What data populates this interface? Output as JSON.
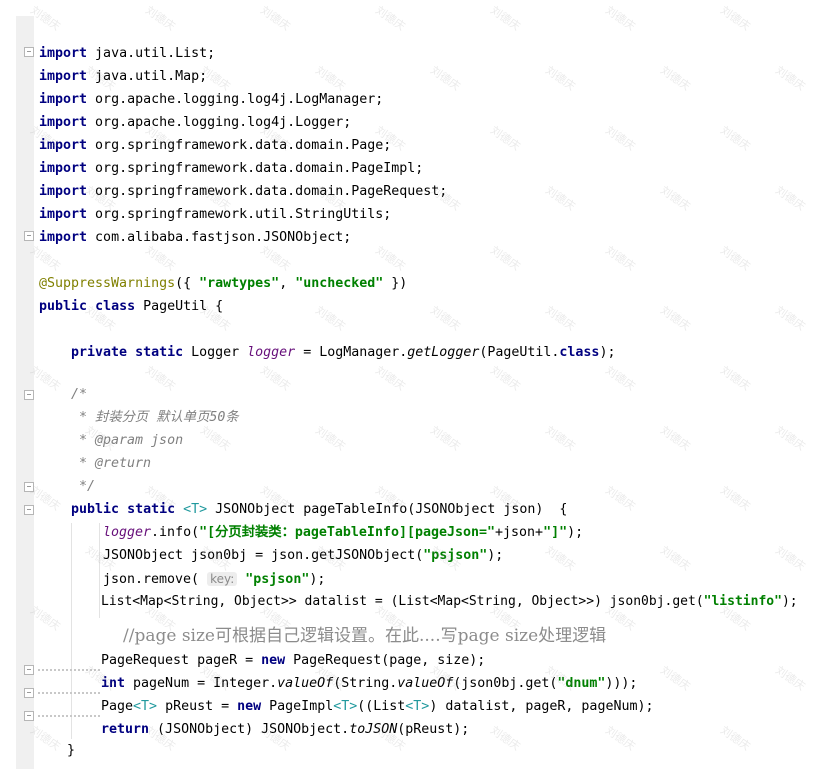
{
  "code": {
    "imports": [
      {
        "keyword": "import",
        "path": " java.util.List;"
      },
      {
        "keyword": "import",
        "path": " java.util.Map;"
      },
      {
        "keyword": "import",
        "path": " org.apache.logging.log4j.LogManager;"
      },
      {
        "keyword": "import",
        "path": " org.apache.logging.log4j.Logger;"
      },
      {
        "keyword": "import",
        "path": " org.springframework.data.domain.Page;"
      },
      {
        "keyword": "import",
        "path": " org.springframework.data.domain.PageImpl;"
      },
      {
        "keyword": "import",
        "path": " org.springframework.data.domain.PageRequest;"
      },
      {
        "keyword": "import",
        "path": " org.springframework.util.StringUtils;"
      },
      {
        "keyword": "import",
        "path": " com.alibaba.fastjson.JSONObject;"
      }
    ],
    "annotation": "@SuppressWarnings",
    "annotation_open": "({ ",
    "annotation_str1": "\"rawtypes\"",
    "annotation_sep": ", ",
    "annotation_str2": "\"unchecked\"",
    "annotation_close": " })",
    "kw_public": "public",
    "kw_class": "class",
    "class_rest": " PageUtil {",
    "kw_private": "private",
    "kw_static": "static",
    "logger_type": " Logger ",
    "logger_field": "logger",
    "logger_eq": " = LogManager.",
    "logger_method": "getLogger",
    "logger_arg": "(PageUtil.",
    "kw_class2": "class",
    "logger_end": ");",
    "doc_open": "/*",
    "doc_line1": " * 封装分页 默认单页50条",
    "doc_line2": " * @param json",
    "doc_line3": " * @return",
    "doc_close": " */",
    "m_public": "public",
    "m_static": "static",
    "m_generic": "<T>",
    "m_sig": " JSONObject pageTableInfo(JSONObject json)  {",
    "l1_field": "logger",
    "l1_mid": ".info(",
    "l1_str1": "\"[分页封装类：pageTableInfo][pageJson=\"",
    "l1_plus": "+json+",
    "l1_str2": "\"]\"",
    "l1_end": ");",
    "l2_pre": "JSONObject json0bj = json.getJSONObject(",
    "l2_str": "\"psjson\"",
    "l2_end": ");",
    "l3_pre": "json.remove( ",
    "l3_hint": "key:",
    "l3_str": "\"psjson\"",
    "l3_end": ");",
    "l4_pre": "List<Map<String, Object>> datalist = (List<Map<String, Object>>) json0bj.get(",
    "l4_str": "\"listinfo\"",
    "l4_end": ");",
    "l5_comment": "//page size可根据自己逻辑设置。在此....写page size处理逻辑",
    "l6_pre": "PageRequest pageR = ",
    "l6_kw": "new",
    "l6_end": " PageRequest(page, size);",
    "l7_kw": "int",
    "l7_pre": " pageNum = Integer.",
    "l7_m1": "valueOf",
    "l7_mid": "(String.",
    "l7_m2": "valueOf",
    "l7_mid2": "(json0bj.get(",
    "l7_str": "\"dnum\"",
    "l7_end": ")));",
    "l8_pre": "Page",
    "l8_g1": "<T>",
    "l8_mid": " pReust = ",
    "l8_kw": "new",
    "l8_mid2": " PageImpl",
    "l8_g2": "<T>",
    "l8_mid3": "((List",
    "l8_g3": "<T>",
    "l8_end": ") datalist, pageR, pageNum);",
    "l9_kw": "return",
    "l9_pre": " (JSONObject) JSONObject.",
    "l9_m": "toJSON",
    "l9_end": "(pReust);",
    "close_brace": "}"
  },
  "watermark": "刘德庆",
  "colors": {
    "keyword": "#000080",
    "string": "#008000",
    "annotation": "#808000",
    "comment": "#808080",
    "field": "#660e7a",
    "generic": "#20999d"
  }
}
